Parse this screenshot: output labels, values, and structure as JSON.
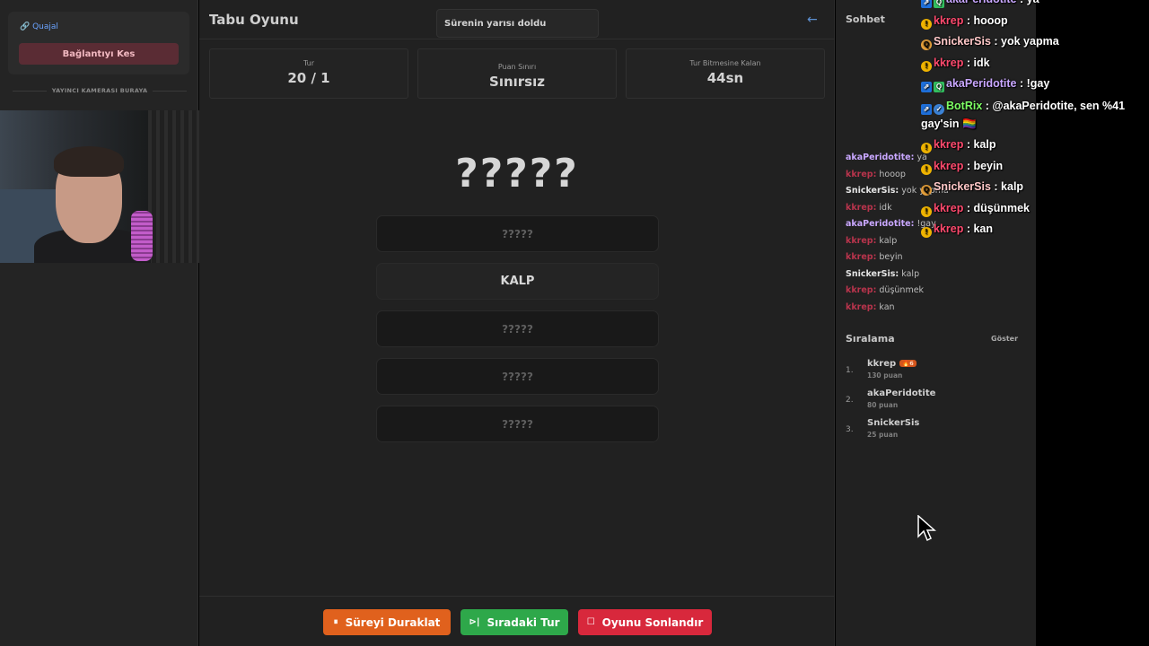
{
  "sidebar": {
    "account": "🔗 Quajal",
    "disconnect_label": "Bağlantıyı Kes",
    "camera_label": "YAYINCI KAMERASI BURAYA"
  },
  "header": {
    "title": "Tabu Oyunu",
    "toast": "Sürenin yarısı doldu",
    "back_icon": "←"
  },
  "stats": {
    "round_label": "Tur",
    "round_value": "20 / 1",
    "limit_label": "Puan Sınırı",
    "limit_value": "Sınırsız",
    "time_label": "Tur Bitmesine Kalan",
    "time_value": "44sn"
  },
  "word": {
    "secret": "?????",
    "taboo": [
      "?????",
      "KALP",
      "?????",
      "?????",
      "?????"
    ]
  },
  "controls": {
    "pause_label": "Süreyi Duraklat",
    "next_label": "Sıradaki Tur",
    "end_label": "Oyunu Sonlandır"
  },
  "chat": {
    "title": "Sohbet",
    "messages": [
      {
        "user": "akaPeridotite:",
        "text": "ya",
        "color": "#c9a7ff"
      },
      {
        "user": "kkrep:",
        "text": "hooop",
        "color": "#b8344c"
      },
      {
        "user": "SnickerSis:",
        "text": "yok yapma",
        "color": "#e4e4e4"
      },
      {
        "user": "kkrep:",
        "text": "idk",
        "color": "#b8344c"
      },
      {
        "user": "akaPeridotite:",
        "text": "!gay",
        "color": "#c9a7ff"
      },
      {
        "user": "kkrep:",
        "text": "kalp",
        "color": "#b8344c"
      },
      {
        "user": "kkrep:",
        "text": "beyin",
        "color": "#b8344c"
      },
      {
        "user": "SnickerSis:",
        "text": "kalp",
        "color": "#e4e4e4"
      },
      {
        "user": "kkrep:",
        "text": "düşünmek",
        "color": "#b8344c"
      },
      {
        "user": "kkrep:",
        "text": "kan",
        "color": "#b8344c"
      }
    ]
  },
  "ranking": {
    "title": "Sıralama",
    "show_label": "Göster",
    "rows": [
      {
        "pos": "1.",
        "name": "kkrep",
        "badge": "🔥6",
        "points": "130 puan"
      },
      {
        "pos": "2.",
        "name": "akaPeridotite",
        "badge": "",
        "points": "80 puan"
      },
      {
        "pos": "3.",
        "name": "SnickerSis",
        "badge": "",
        "points": "25 puan"
      }
    ]
  },
  "overlay_chat": [
    {
      "badges": [
        "sq",
        "mod"
      ],
      "user": "akaPeridotite",
      "text": " : ya",
      "color": "#c9a7ff",
      "wrap": false
    },
    {
      "badges": [
        "gold"
      ],
      "user": "kkrep",
      "text": " : hooop",
      "color": "#ff4a6e",
      "wrap": false
    },
    {
      "badges": [
        "orange"
      ],
      "user": "SnickerSis",
      "text": " : yok yapma",
      "color": "#ffc8c8",
      "wrap": false
    },
    {
      "badges": [
        "gold"
      ],
      "user": "kkrep",
      "text": " : idk",
      "color": "#ff4a6e",
      "wrap": false
    },
    {
      "badges": [
        "sq",
        "mod"
      ],
      "user": "akaPeridotite",
      "text": " : !gay",
      "color": "#c9a7ff",
      "wrap": false
    },
    {
      "badges": [
        "sq",
        "vip"
      ],
      "user": "BotRix",
      "text": " : @akaPeridotite, sen %41 gay'sin 🏳️‍🌈",
      "color": "#7dff64",
      "wrap": true
    },
    {
      "badges": [
        "gold"
      ],
      "user": "kkrep",
      "text": " : kalp",
      "color": "#ff4a6e",
      "wrap": false
    },
    {
      "badges": [
        "gold"
      ],
      "user": "kkrep",
      "text": " : beyin",
      "color": "#ff4a6e",
      "wrap": false
    },
    {
      "badges": [
        "orange"
      ],
      "user": "SnickerSis",
      "text": " : kalp",
      "color": "#ffc8c8",
      "wrap": false
    },
    {
      "badges": [
        "gold"
      ],
      "user": "kkrep",
      "text": " : düşünmek",
      "color": "#ff4a6e",
      "wrap": false
    },
    {
      "badges": [
        "gold"
      ],
      "user": "kkrep",
      "text": " : kan",
      "color": "#ff4a6e",
      "wrap": false
    }
  ]
}
